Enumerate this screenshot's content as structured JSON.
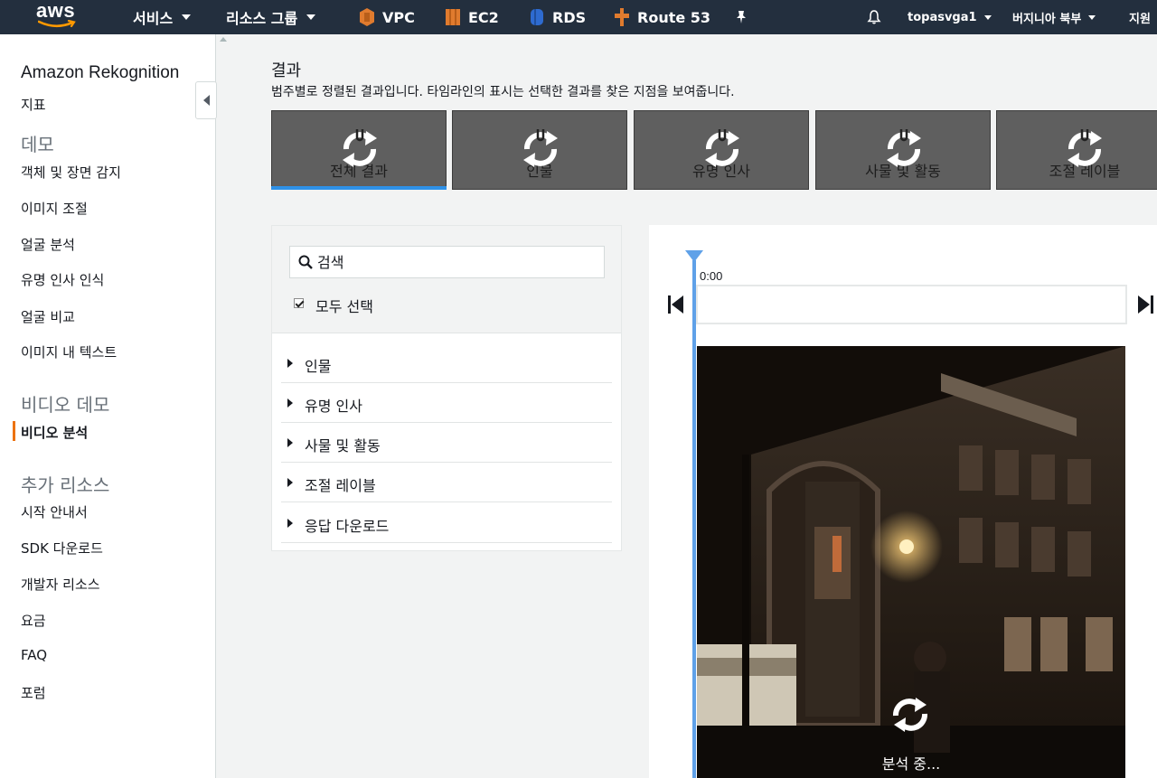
{
  "topnav": {
    "logo_text": "aws",
    "services": "서비스",
    "resource_groups": "리소스 그룹",
    "shortcuts": [
      {
        "label": "VPC",
        "color": "#e07b2e"
      },
      {
        "label": "EC2",
        "color": "#e07b2e"
      },
      {
        "label": "RDS",
        "color": "#2e6bd0"
      },
      {
        "label": "Route 53",
        "color": "#e07b2e"
      }
    ],
    "pin_icon": "pin-icon",
    "bell_icon": "bell-icon",
    "user": "topasvga1",
    "region": "버지니아 북부",
    "support": "지원"
  },
  "sidebar": {
    "title": "Amazon Rekognition",
    "metrics": "지표",
    "demo_section": "데모",
    "demo_items": [
      "객체 및 장면 감지",
      "이미지 조절",
      "얼굴 분석",
      "유명 인사 인식",
      "얼굴 비교",
      "이미지 내 텍스트"
    ],
    "video_section": "비디오 데모",
    "video_items": [
      "비디오 분석"
    ],
    "extra_section": "추가 리소스",
    "extra_items": [
      "시작 안내서",
      "SDK 다운로드",
      "개발자 리소스",
      "요금",
      "FAQ",
      "포럼"
    ]
  },
  "main": {
    "heading": "결과",
    "subheading": "범주별로 정렬된 결과입니다. 타임라인의 표시는 선택한 결과를 찾은 지점을 보여줍니다.",
    "tabs": [
      "전체 결과",
      "인물",
      "유명 인사",
      "사물 및 활동",
      "조절 레이블"
    ],
    "search_placeholder": "검색",
    "select_all": "모두 선택",
    "categories": [
      "인물",
      "유명 인사",
      "사물 및 활동",
      "조절 레이블",
      "응답 다운로드"
    ],
    "time_label": "0:00",
    "analyzing": "분석 중...",
    "accent_color": "#2e91e8",
    "timeline_color": "#5fa1e8"
  }
}
